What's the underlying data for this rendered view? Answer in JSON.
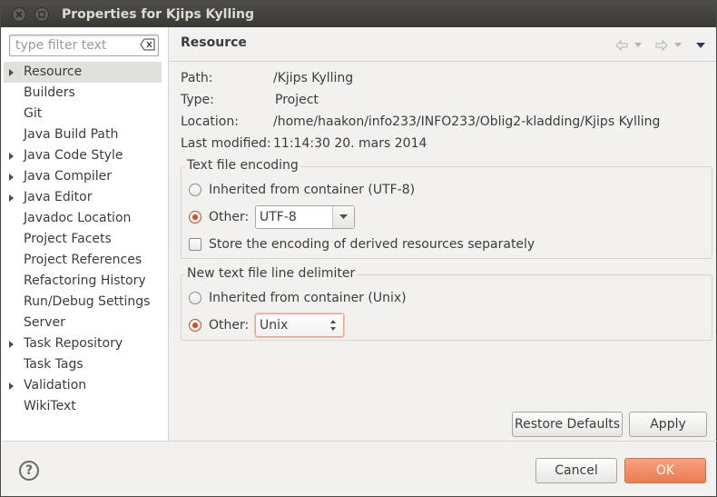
{
  "window": {
    "title": "Properties for Kjips Kylling"
  },
  "filter": {
    "placeholder": "type filter text"
  },
  "tree": {
    "items": [
      {
        "label": "Resource",
        "expandable": true,
        "selected": true
      },
      {
        "label": "Builders",
        "expandable": false
      },
      {
        "label": "Git",
        "expandable": false
      },
      {
        "label": "Java Build Path",
        "expandable": false
      },
      {
        "label": "Java Code Style",
        "expandable": true
      },
      {
        "label": "Java Compiler",
        "expandable": true
      },
      {
        "label": "Java Editor",
        "expandable": true
      },
      {
        "label": "Javadoc Location",
        "expandable": false
      },
      {
        "label": "Project Facets",
        "expandable": false
      },
      {
        "label": "Project References",
        "expandable": false
      },
      {
        "label": "Refactoring History",
        "expandable": false
      },
      {
        "label": "Run/Debug Settings",
        "expandable": false
      },
      {
        "label": "Server",
        "expandable": false
      },
      {
        "label": "Task Repository",
        "expandable": true
      },
      {
        "label": "Task Tags",
        "expandable": false
      },
      {
        "label": "Validation",
        "expandable": true
      },
      {
        "label": "WikiText",
        "expandable": false
      }
    ]
  },
  "page": {
    "title": "Resource",
    "props": {
      "path_label": "Path:",
      "path_value": "/Kjips Kylling",
      "type_label": "Type:",
      "type_value": "Project",
      "location_label": "Location:",
      "location_value": "/home/haakon/info233/INFO233/Oblig2-kladding/Kjips Kylling",
      "modified_label": "Last modified:",
      "modified_value": "11:14:30 20. mars 2014"
    },
    "encoding": {
      "title": "Text file encoding",
      "inherited_label": "Inherited from container (UTF-8)",
      "other_label": "Other:",
      "other_value": "UTF-8",
      "store_label": "Store the encoding of derived resources separately"
    },
    "delimiter": {
      "title": "New text file line delimiter",
      "inherited_label": "Inherited from container (Unix)",
      "other_label": "Other:",
      "other_value": "Unix"
    },
    "buttons": {
      "restore": "Restore Defaults",
      "apply": "Apply"
    }
  },
  "footer": {
    "cancel": "Cancel",
    "ok": "OK",
    "help_icon": "?"
  },
  "colors": {
    "accent": "#dd4814",
    "ok_button": "#ea7c52",
    "titlebar": "#3c3b37"
  }
}
